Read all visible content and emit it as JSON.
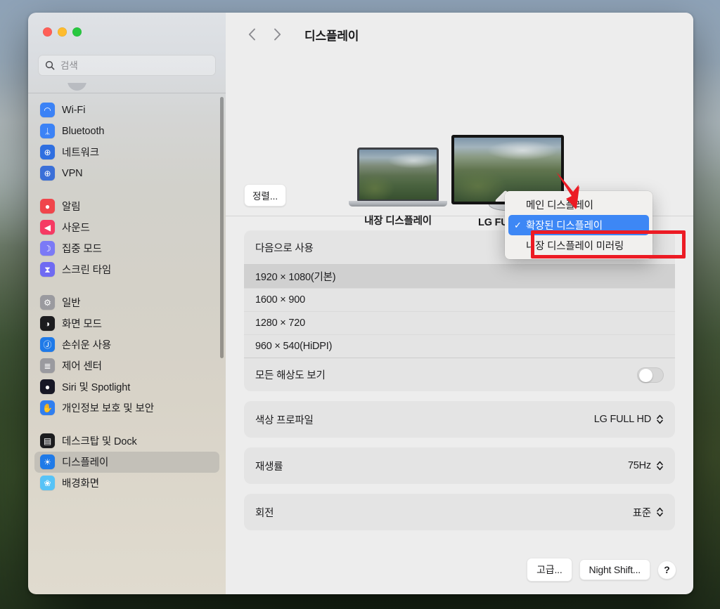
{
  "window": {
    "title": "디스플레이",
    "traffic_lights": [
      "close",
      "minimize",
      "maximize"
    ],
    "nav_back": "‹",
    "nav_forward": "›"
  },
  "sidebar": {
    "search": {
      "placeholder": "검색",
      "value": ""
    },
    "groups": [
      {
        "items": [
          {
            "label": "Wi-Fi",
            "icon": "wifi-icon",
            "color": "#3b82f6",
            "glyph": "◠"
          },
          {
            "label": "Bluetooth",
            "icon": "bluetooth-icon",
            "color": "#3b82f6",
            "glyph": "ᛦ"
          },
          {
            "label": "네트워크",
            "icon": "network-globe-icon",
            "color": "#2f6fe0",
            "glyph": "⊕"
          },
          {
            "label": "VPN",
            "icon": "vpn-globe-icon",
            "color": "#3a6fd8",
            "glyph": "⊕"
          }
        ]
      },
      {
        "items": [
          {
            "label": "알림",
            "icon": "bell-icon",
            "color": "#f0454b",
            "glyph": "●"
          },
          {
            "label": "사운드",
            "icon": "speaker-icon",
            "color": "#f63a63",
            "glyph": "◀"
          },
          {
            "label": "집중 모드",
            "icon": "moon-icon",
            "color": "#7b7af6",
            "glyph": "☽"
          },
          {
            "label": "스크린 타임",
            "icon": "hourglass-icon",
            "color": "#6f6af2",
            "glyph": "⧗"
          }
        ]
      },
      {
        "items": [
          {
            "label": "일반",
            "icon": "gear-icon",
            "color": "#9a9a9f",
            "glyph": "⚙"
          },
          {
            "label": "화면 모드",
            "icon": "appearance-icon",
            "color": "#1c1c1e",
            "glyph": "◑"
          },
          {
            "label": "손쉬운 사용",
            "icon": "accessibility-icon",
            "color": "#1f7ae8",
            "glyph": "Ⓙ"
          },
          {
            "label": "제어 센터",
            "icon": "control-center-icon",
            "color": "#9a9a9f",
            "glyph": "≣"
          },
          {
            "label": "Siri 및 Spotlight",
            "icon": "siri-icon",
            "color": "#171725",
            "glyph": "●"
          },
          {
            "label": "개인정보 보호 및 보안",
            "icon": "privacy-hand-icon",
            "color": "#2f7ff0",
            "glyph": "✋"
          }
        ]
      },
      {
        "items": [
          {
            "label": "데스크탑 및 Dock",
            "icon": "desktop-dock-icon",
            "color": "#1c1c1e",
            "glyph": "▤"
          },
          {
            "label": "디스플레이",
            "icon": "display-brightness-icon",
            "color": "#1f7ae8",
            "glyph": "☀",
            "selected": true
          },
          {
            "label": "배경화면",
            "icon": "wallpaper-icon",
            "color": "#57c3f7",
            "glyph": "❀"
          }
        ]
      }
    ]
  },
  "arrangement": {
    "arrange_button": "정렬...",
    "displays": [
      {
        "name": "내장 디스플레이",
        "type": "laptop"
      },
      {
        "name": "LG FULL HD",
        "type": "monitor"
      }
    ]
  },
  "popup_menu": {
    "items": [
      {
        "label": "메인 디스플레이",
        "checked": false
      },
      {
        "label": "확장된 디스플레이",
        "checked": true
      },
      {
        "label": "내장 디스플레이 미러링",
        "checked": false
      }
    ],
    "check_glyph": "✓",
    "highlight_color": "#3d87f5"
  },
  "annotations": {
    "box_color": "#ec1b24",
    "arrow_color": "#ec1b24"
  },
  "use_as": {
    "label": "다음으로 사용"
  },
  "resolutions": {
    "options": [
      {
        "label": "1920 × 1080(기본)",
        "selected": true
      },
      {
        "label": "1600 × 900",
        "selected": false
      },
      {
        "label": "1280 × 720",
        "selected": false
      },
      {
        "label": "960 × 540(HiDPI)",
        "selected": false
      }
    ],
    "show_all_label": "모든 해상도 보기",
    "show_all_enabled": false
  },
  "settings_rows": [
    {
      "label": "색상 프로파일",
      "value": "LG FULL HD"
    },
    {
      "label": "재생률",
      "value": "75Hz"
    },
    {
      "label": "회전",
      "value": "표준"
    }
  ],
  "bottom_buttons": {
    "advanced": "고급...",
    "night_shift": "Night Shift...",
    "help": "?"
  }
}
